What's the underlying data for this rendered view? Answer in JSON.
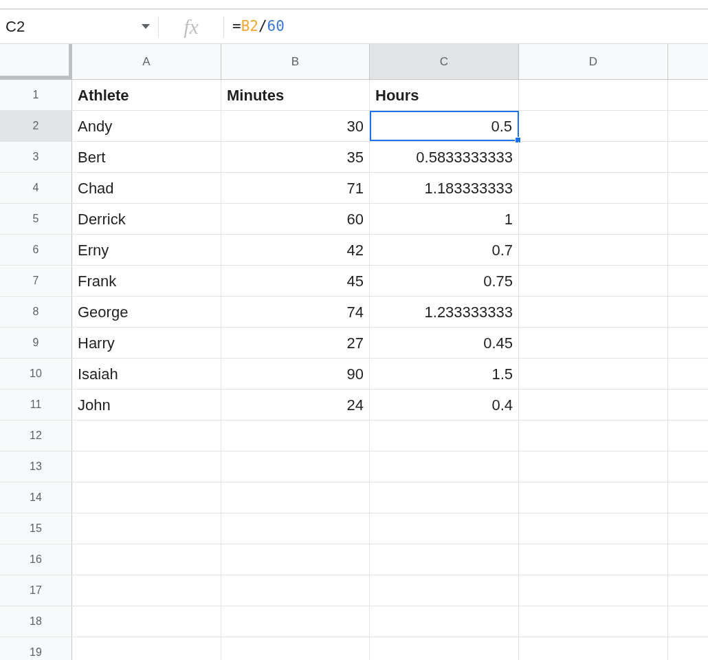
{
  "formula_bar": {
    "name_box": "C2",
    "fx_label": "fx",
    "formula": [
      {
        "text": "=",
        "kind": "operator"
      },
      {
        "text": "B2",
        "kind": "ref"
      },
      {
        "text": "/",
        "kind": "operator"
      },
      {
        "text": "60",
        "kind": "number"
      }
    ]
  },
  "columns": [
    {
      "label": "A",
      "selected": false
    },
    {
      "label": "B",
      "selected": false
    },
    {
      "label": "C",
      "selected": true
    },
    {
      "label": "D",
      "selected": false
    }
  ],
  "rows": [
    {
      "number": "1",
      "selected": false,
      "cells": [
        {
          "text": "Athlete",
          "kind": "header",
          "selected": false
        },
        {
          "text": "Minutes",
          "kind": "header",
          "selected": false
        },
        {
          "text": "Hours",
          "kind": "header",
          "selected": false
        }
      ]
    },
    {
      "number": "2",
      "selected": true,
      "cells": [
        {
          "text": "Andy",
          "kind": "text",
          "selected": false
        },
        {
          "text": "30",
          "kind": "number",
          "selected": false
        },
        {
          "text": "0.5",
          "kind": "number",
          "selected": true
        }
      ]
    },
    {
      "number": "3",
      "selected": false,
      "cells": [
        {
          "text": "Bert",
          "kind": "text",
          "selected": false
        },
        {
          "text": "35",
          "kind": "number",
          "selected": false
        },
        {
          "text": "0.5833333333",
          "kind": "number",
          "selected": false
        }
      ]
    },
    {
      "number": "4",
      "selected": false,
      "cells": [
        {
          "text": "Chad",
          "kind": "text",
          "selected": false
        },
        {
          "text": "71",
          "kind": "number",
          "selected": false
        },
        {
          "text": "1.183333333",
          "kind": "number",
          "selected": false
        }
      ]
    },
    {
      "number": "5",
      "selected": false,
      "cells": [
        {
          "text": "Derrick",
          "kind": "text",
          "selected": false
        },
        {
          "text": "60",
          "kind": "number",
          "selected": false
        },
        {
          "text": "1",
          "kind": "number",
          "selected": false
        }
      ]
    },
    {
      "number": "6",
      "selected": false,
      "cells": [
        {
          "text": "Erny",
          "kind": "text",
          "selected": false
        },
        {
          "text": "42",
          "kind": "number",
          "selected": false
        },
        {
          "text": "0.7",
          "kind": "number",
          "selected": false
        }
      ]
    },
    {
      "number": "7",
      "selected": false,
      "cells": [
        {
          "text": "Frank",
          "kind": "text",
          "selected": false
        },
        {
          "text": "45",
          "kind": "number",
          "selected": false
        },
        {
          "text": "0.75",
          "kind": "number",
          "selected": false
        }
      ]
    },
    {
      "number": "8",
      "selected": false,
      "cells": [
        {
          "text": "George",
          "kind": "text",
          "selected": false
        },
        {
          "text": "74",
          "kind": "number",
          "selected": false
        },
        {
          "text": "1.233333333",
          "kind": "number",
          "selected": false
        }
      ]
    },
    {
      "number": "9",
      "selected": false,
      "cells": [
        {
          "text": "Harry",
          "kind": "text",
          "selected": false
        },
        {
          "text": "27",
          "kind": "number",
          "selected": false
        },
        {
          "text": "0.45",
          "kind": "number",
          "selected": false
        }
      ]
    },
    {
      "number": "10",
      "selected": false,
      "cells": [
        {
          "text": "Isaiah",
          "kind": "text",
          "selected": false
        },
        {
          "text": "90",
          "kind": "number",
          "selected": false
        },
        {
          "text": "1.5",
          "kind": "number",
          "selected": false
        }
      ]
    },
    {
      "number": "11",
      "selected": false,
      "cells": [
        {
          "text": "John",
          "kind": "text",
          "selected": false
        },
        {
          "text": "24",
          "kind": "number",
          "selected": false
        },
        {
          "text": "0.4",
          "kind": "number",
          "selected": false
        }
      ]
    },
    {
      "number": "12",
      "selected": false
    },
    {
      "number": "13",
      "selected": false
    },
    {
      "number": "14",
      "selected": false
    },
    {
      "number": "15",
      "selected": false
    },
    {
      "number": "16",
      "selected": false
    },
    {
      "number": "17",
      "selected": false
    },
    {
      "number": "18",
      "selected": false
    },
    {
      "number": "19",
      "selected": false
    }
  ]
}
